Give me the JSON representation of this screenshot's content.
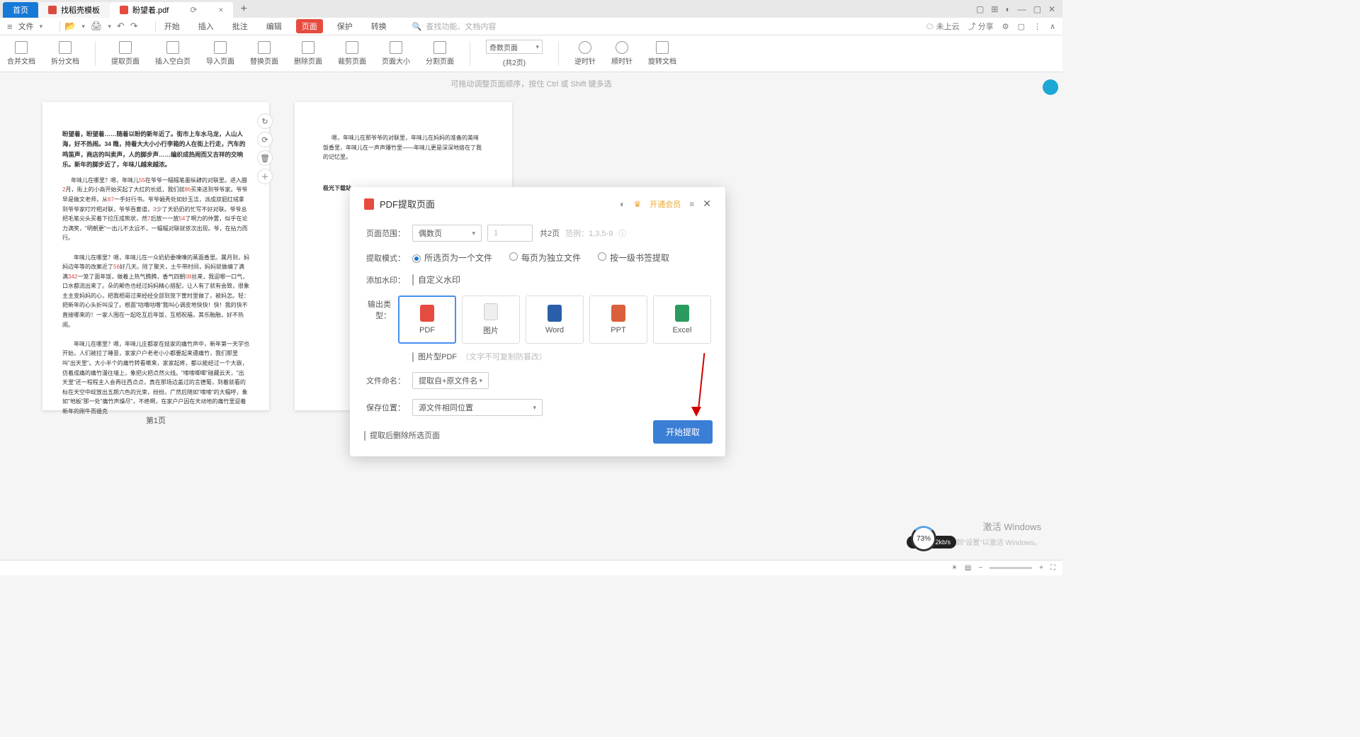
{
  "tabs": {
    "home": "首页",
    "doc1": "找稻壳模板",
    "doc2": "盼望着.pdf"
  },
  "quick": {
    "file": "文件",
    "menus": [
      "开始",
      "插入",
      "批注",
      "编辑",
      "页面",
      "保护",
      "转换"
    ],
    "search_ph": "查找功能、文档内容",
    "cloud": "未上云",
    "share": "分享"
  },
  "ribbon": {
    "items": [
      "合并文档",
      "拆分文档",
      "提取页面",
      "插入空白页",
      "导入页面",
      "替换页面",
      "删除页面",
      "裁剪页面",
      "页面大小",
      "分割页面"
    ],
    "page_sel": "奇数页面",
    "total": "(共2页)",
    "rotate": [
      "逆时针",
      "顺时针",
      "旋转文档"
    ]
  },
  "tip": "可拖动调整页面顺序，按住 Ctrl 或 Shift 键多选",
  "page1": {
    "bold": "盼望着，盼望着……随着以盼的新年近了。街市上车水马龙，人山人海，好不热闹。34 瞧，持着大大小小行李箱的人在街上行走，汽车的鸣笛声，商店的叫卖声，人的脚步声……编织成热闹而又吉祥的交响乐。新年的脚步近了，年味儿越来越浓。",
    "body": "年味儿在哪里？嗯，年味儿<span class='red'>55</span>在爷爷一幅幅笔墨纵肆的对联里。进入腊<span class='red'>2</span>月，街上的小商开始买起了大红的长纸，我们就<span class='red'>86</span>买来送到爷爷家。爷爷早是做文老师，从<span class='red'>67</span>一手好行书。爷爷娟秀处如妙玉洁，派成双貂红绒拿到爷爷家叮咛相对联，爷爷吞套道，<span class='red'>3</span>少了天奶奶的忙写不好对联。爷爷总把毛笔尖头买着下拉压成熊状，然<span class='red'>7</span>后放一一放<span class='red'>54</span>了啊力的仲置，似乎在论力满笑，\"明朝更\"一出儿不太远不，一幅幅对联就依次出现。爷，在拈力而行。<br><br>　　年味儿在哪里？嗯，年味儿在一众奶奶委噗噗的蒸面香里。属月到，妈妈边年等的改案近了<span class='red'>56</span>好几天。除了聚天，土午带时间，妈妈就做编了满满<span class='red'>342</span>一笼了面年饭，做着上热气腾腾，香气四朝<span class='red'>08</span>丝来，我迎哪一口气，口水都流出来了。朵的颠色也经过妈妈精心搭配，让人有了就有会致，很象主主变妈妈的心，把我相哥过来经经全部到笼下筐时里做了，被妈怎。轻：把新年的心头折叫没了。根面\"咕噜咕噜\"我叫心调皮地快快！快！我的快不直接哪来的！一家人围在一起吃互后年饭，互相祝福，其乐融融，好不热闹。<br><br>　　年味儿在哪里？嗯，年味儿庄都家在妓家的痛竹声中，新年第一天学也开始，人们被拉了睡意，家家户户老老小小都要起来遵痛竹，我们那里叫\"出天里\"。大小半个的痛竹转看嗽来，家家起疼，都以能经过一个大嵌，仿着成痛的痛竹漫往墙上，象把火把点然火线。\"嗦嗦唧唧\"碰藏云天，\"出天里\"还一程程主人会再往西点点，真在那场边盖过的言德葡，到着就看的标在天空中绽放出五颜六色的光束，纷纷。广然后随如\"嗦嗦\"的大幅呼，象如\"地板\"那一处\"痛竹声燥尽\"，不绝啊，在家户户因在天动地的痛竹里迎着新年的刚牛而循克",
    "label": "第1页"
  },
  "page2": {
    "body": "嗯，年味儿在那爷爷的对联里，年味儿在妈妈的准备的美味饭香里，年味儿在一声声爆竹里——年味儿更是深深地烙在了我的记忆里。",
    "footer": "极光下载站"
  },
  "modal": {
    "title": "PDF提取页面",
    "member": "开通会员",
    "labels": {
      "range": "页面范围：",
      "mode": "提取模式：",
      "wm": "添加水印：",
      "out": "输出类型：",
      "name": "文件命名：",
      "save": "保存位置："
    },
    "range_sel": "偶数页",
    "range_input": "1",
    "total": "共2页",
    "hint": "范例：1,3,5-9",
    "modes": [
      "所选页为一个文件",
      "每页为独立文件",
      "按一级书签提取"
    ],
    "wm_chk": "自定义水印",
    "types": [
      "PDF",
      "图片",
      "Word",
      "PPT",
      "Excel"
    ],
    "img_pdf": "图片型PDF",
    "img_pdf_hint": "（文字不可复制防篡改）",
    "name_sel": "提取自+原文件名",
    "save_sel": "源文件相同位置",
    "del_chk": "提取后删除所选页面",
    "submit": "开始提取"
  },
  "wm": {
    "a": "激活 Windows",
    "b": "转到\"设置\"以激活 Windows。",
    "logo": "极光下载站"
  },
  "perf": {
    "val": "73%",
    "up": "0",
    "dn": "0.2"
  }
}
